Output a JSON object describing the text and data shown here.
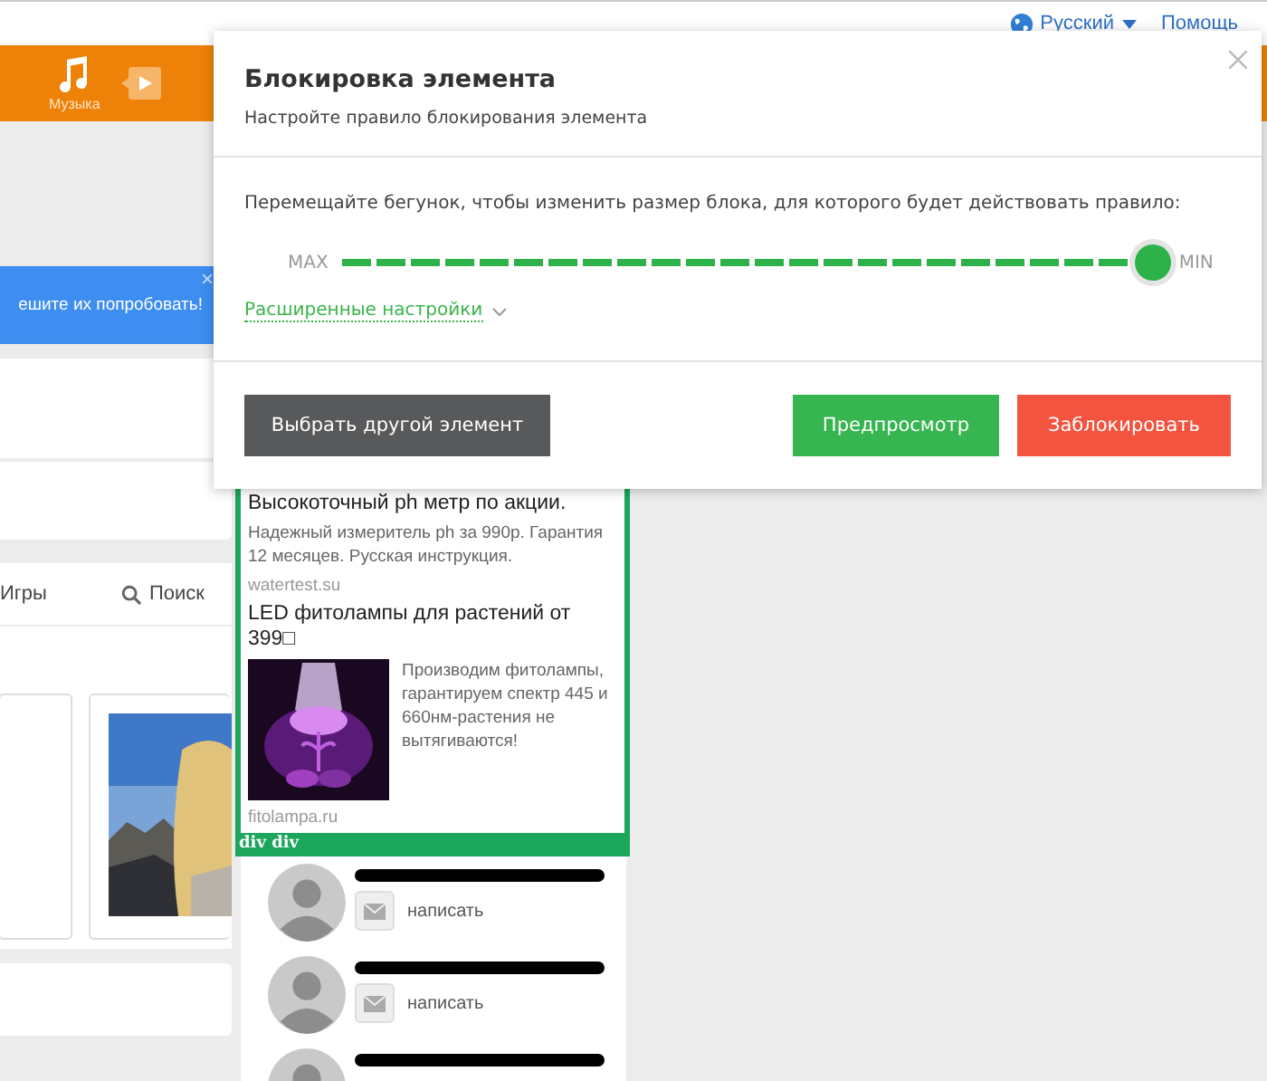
{
  "top_bar": {
    "language": "Русский",
    "help": "Помощь"
  },
  "nav": [
    {
      "kind": "music",
      "label": "Музыка"
    },
    {
      "kind": "video"
    }
  ],
  "notification": {
    "text": "ешите их попробовать!",
    "close": "×"
  },
  "tabs": [
    {
      "kind": "plain",
      "label": "Игры"
    },
    {
      "kind": "search",
      "label": "Поиск"
    }
  ],
  "ad": {
    "items": [
      {
        "title": "Высокоточный ph метр по акции.",
        "text": "Надежный измеритель ph за 990р. Гарантия 12 месяцев. Русская инструкция.",
        "domain": "watertest.su"
      },
      {
        "title": "LED фитолампы для растений от 399□",
        "text": "Производим фитолампы, гарантируем спектр 445 и 660нм-растения не вытягиваются!",
        "domain": "fitolampa.ru"
      }
    ],
    "label": "div div"
  },
  "friends": [
    {
      "kind": "full",
      "action": "написать"
    },
    {
      "kind": "full",
      "action": "написать"
    },
    {
      "kind": "cut"
    }
  ],
  "dialog": {
    "title": "Блокировка элемента",
    "subtitle": "Настройте правило блокирования элемента",
    "prompt": "Перемещайте бегунок, чтобы изменить размер блока, для которого будет действовать правило:",
    "slider": {
      "start_label": "MAX",
      "end_label": "MIN",
      "level": 1
    },
    "advanced_link": "Расширенные настройки",
    "buttons": [
      {
        "kind": "secondary",
        "label": "Выбрать другой элемент"
      },
      {
        "kind": "preview",
        "label": "Предпросмотр"
      },
      {
        "kind": "danger",
        "label": "Заблокировать"
      }
    ]
  }
}
